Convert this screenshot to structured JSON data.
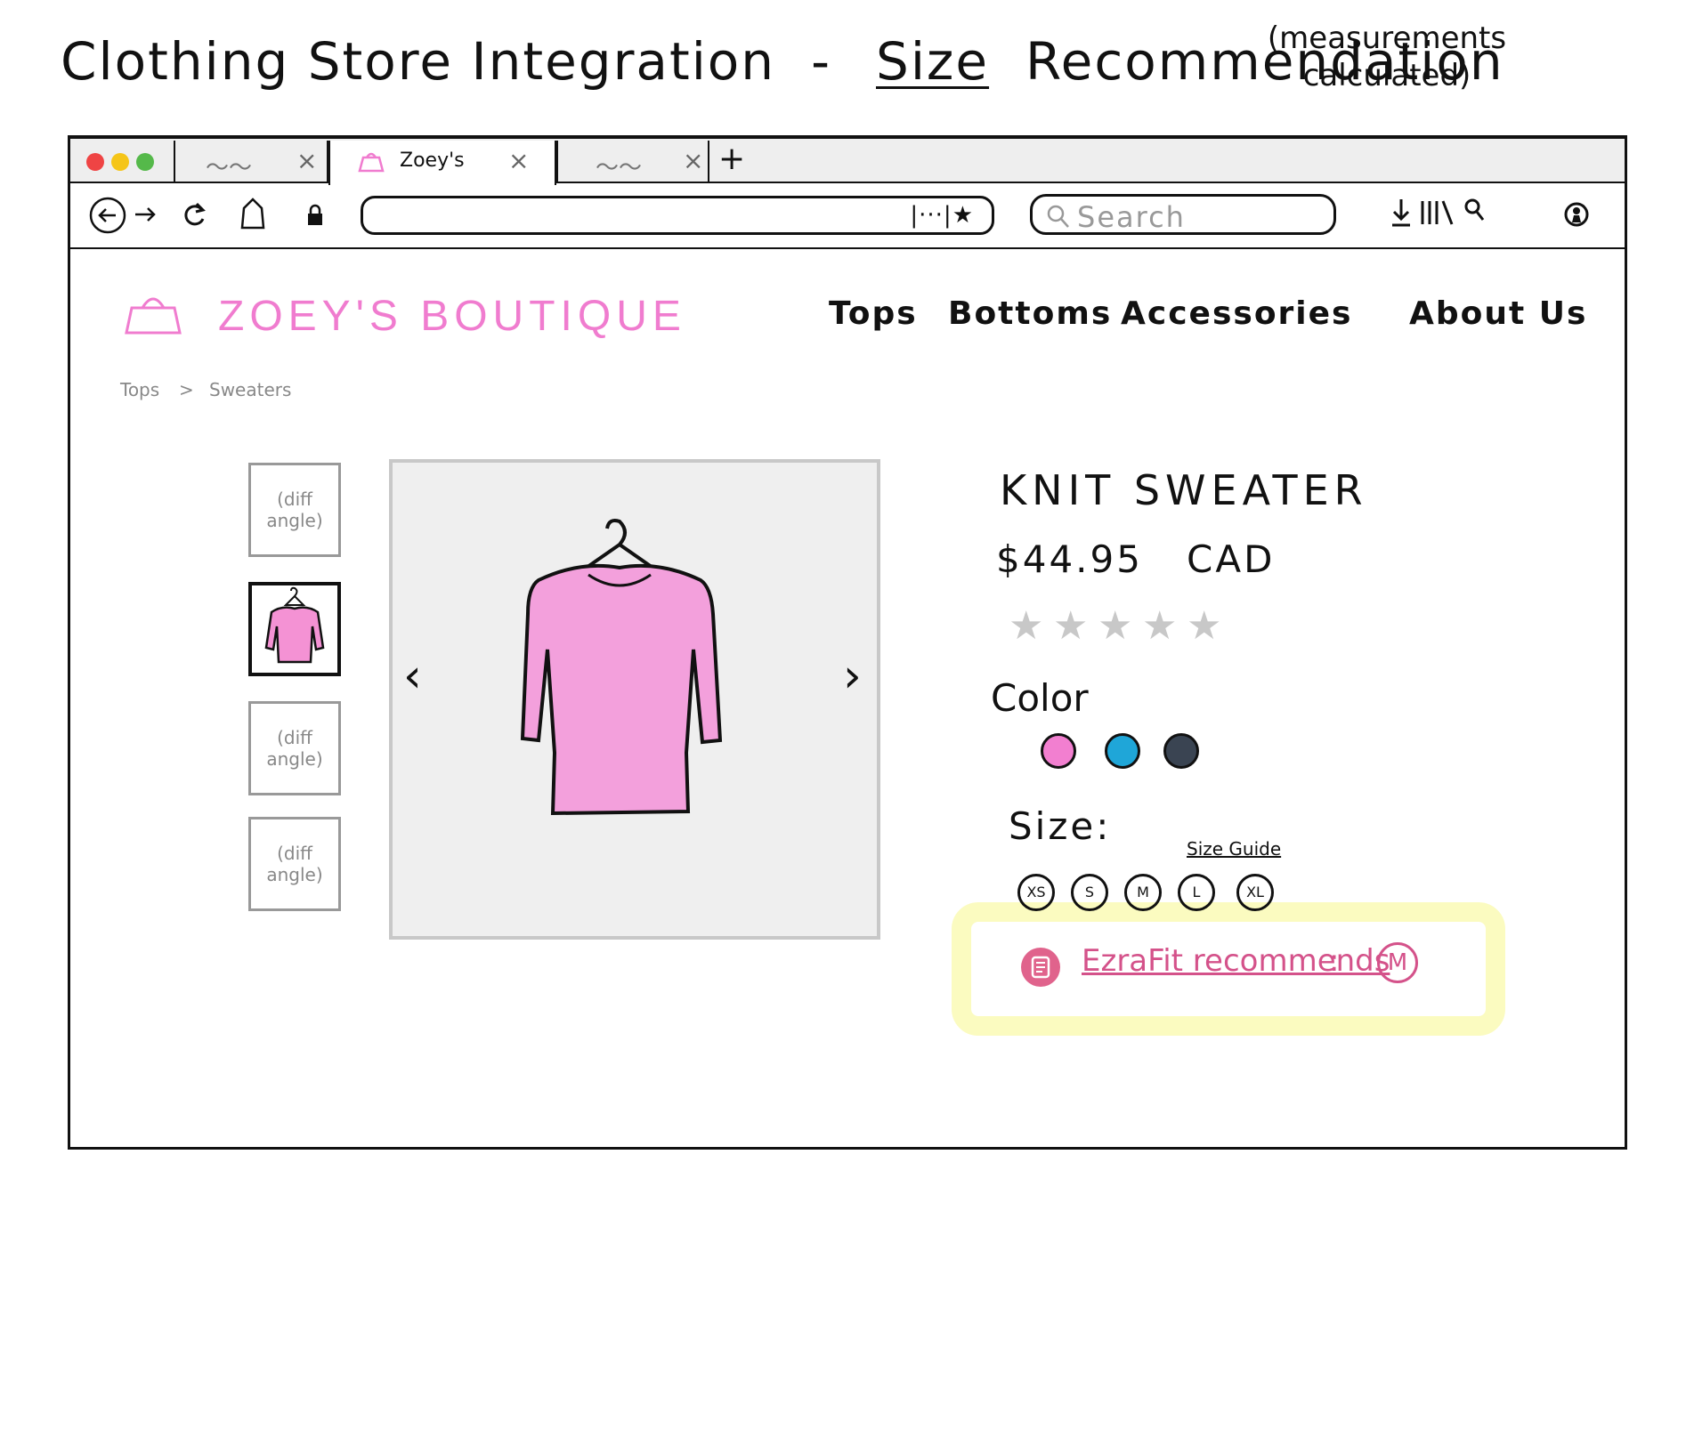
{
  "sketch": {
    "title_main": "Clothing Store Integration",
    "title_dash": "-",
    "title_size": "Size",
    "title_rec": "Recommendation",
    "note_line1": "(measurements",
    "note_line2": "calculated)"
  },
  "browser": {
    "tabs": [
      {
        "label": "",
        "active": false
      },
      {
        "label": "Zoey's",
        "active": true
      },
      {
        "label": "",
        "active": false
      }
    ],
    "new_tab_label": "+",
    "search_placeholder": "Search",
    "url_actions": "|···|★"
  },
  "site": {
    "brand": "ZOEY'S BOUTIQUE",
    "brand_color": "#f07ccf",
    "nav": [
      "Tops",
      "Bottoms",
      "Accessories",
      "About Us"
    ],
    "breadcrumb": [
      "Tops",
      ">",
      "Sweaters"
    ]
  },
  "gallery": {
    "thumbs": [
      {
        "line1": "(diff",
        "line2": "angle)"
      },
      {
        "line1": "(diff",
        "line2": "angle)"
      },
      {
        "line1": "(diff",
        "line2": "angle)"
      }
    ],
    "prev": "‹",
    "next": "›"
  },
  "product": {
    "name": "KNIT SWEATER",
    "price": "$44.95",
    "currency": "CAD",
    "rating": 0,
    "rating_max": 5,
    "color_label": "Color",
    "colors": [
      "#f27fd0",
      "#1fa6d8",
      "#3a4452"
    ],
    "size_label": "Size:",
    "size_guide": "Size Guide",
    "sizes": [
      "XS",
      "S",
      "M",
      "L",
      "XL"
    ]
  },
  "recommendation": {
    "link_text": "EzraFit recommends",
    "colon": ":",
    "size": "M",
    "accent": "#d4528a",
    "highlight": "#fbfbc0"
  }
}
